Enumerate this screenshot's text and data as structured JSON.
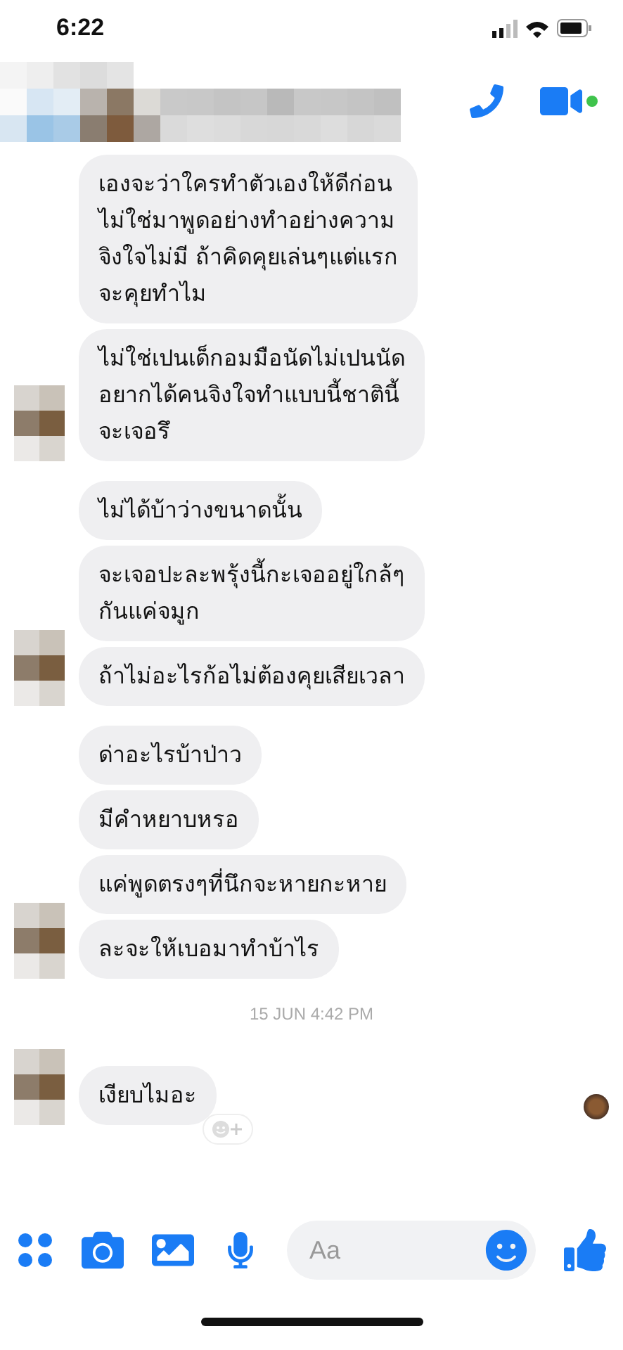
{
  "status_bar": {
    "time": "6:22"
  },
  "header": {
    "actions": [
      {
        "kind": "call"
      },
      {
        "kind": "video"
      }
    ],
    "online": true
  },
  "groups": [
    {
      "messages": [
        "เองจะว่าใครทำตัวเองให้ดีก่อน\nไม่ใช่มาพูดอย่างทำอย่างความ\nจิงใจไม่มี ถ้าคิดคุยเล่นๆแต่แรก\nจะคุยทำไม",
        "ไม่ใช่เปนเด็กอมมือนัดไม่เปนนัด\nอยากได้คนจิงใจทำแบบนี้ชาตินี้\nจะเจอรึ"
      ]
    },
    {
      "messages": [
        "ไม่ได้บ้าว่างขนาดนั้น",
        "จะเจอปะละพรุ้งนี้กะเจออยู่ใกล้ๆ\nกันแค่จมูก",
        "ถ้าไม่อะไรก้อไม่ต้องคุยเสียเวลา"
      ]
    },
    {
      "messages": [
        "ด่าอะไรบ้าป่าว",
        "มีคำหยาบหรอ",
        "แค่พูดตรงๆที่นึกจะหายกะหาย",
        "ละจะให้เบอมาทำบ้าไร"
      ]
    },
    {
      "timestamp": "15 JUN 4:42 PM",
      "messages": [
        "เงียบไมอะ"
      ],
      "reaction_button": true,
      "read_receipt": true
    }
  ],
  "composer": {
    "placeholder": "Aa"
  }
}
